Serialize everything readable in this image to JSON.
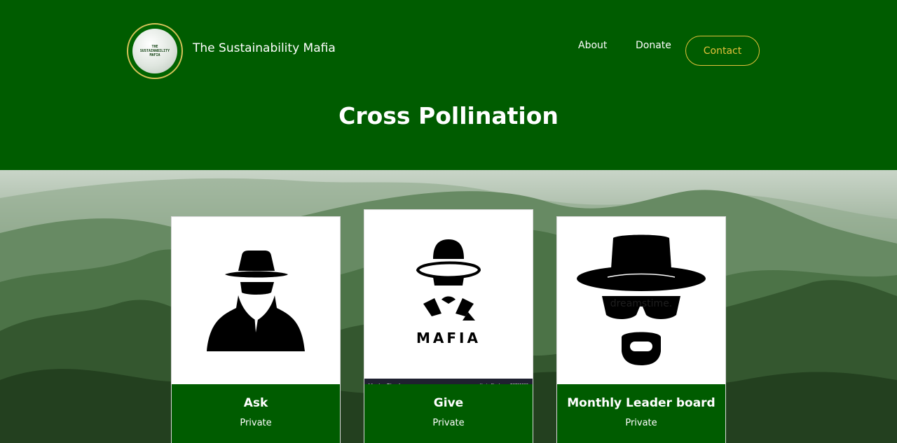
{
  "header": {
    "logo_text": [
      "THE",
      "SUSTAINABILITY",
      "MAFIA"
    ],
    "brand": "The Sustainability Mafia",
    "nav": [
      "About",
      "Donate"
    ],
    "contact": "Contact",
    "title": "Cross Pollination"
  },
  "cards": [
    {
      "title": "Ask",
      "subtitle": "Private",
      "icon": "spy-icon"
    },
    {
      "title": "Give",
      "subtitle": "Private",
      "icon": "mafia-icon",
      "image_caption": "MAFIA",
      "watermark": "VectorStock",
      "watermark_id": "VectorStock.com/38726066"
    },
    {
      "title": "Monthly Leader board",
      "subtitle": "Private",
      "icon": "hat-sunglasses-icon",
      "watermark": "dreamstime."
    }
  ],
  "colors": {
    "header_bg": "#005c00",
    "accent": "#e3c13b",
    "card_body": "#005c00"
  }
}
